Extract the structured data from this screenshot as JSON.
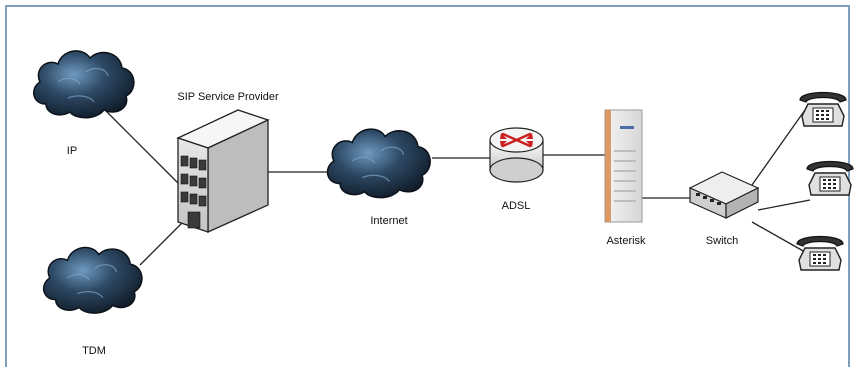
{
  "nodes": {
    "ip": {
      "label": "IP",
      "icon": "cloud-icon"
    },
    "tdm": {
      "label": "TDM",
      "icon": "cloud-icon"
    },
    "sip_provider": {
      "label": "SIP Service Provider",
      "icon": "building-icon"
    },
    "internet": {
      "label": "Internet",
      "icon": "cloud-icon"
    },
    "adsl": {
      "label": "ADSL",
      "icon": "router-icon"
    },
    "asterisk": {
      "label": "Asterisk",
      "icon": "pbx-server-icon"
    },
    "switch": {
      "label": "Switch",
      "icon": "network-switch-icon"
    },
    "phones": [
      {
        "icon": "telephone-icon"
      },
      {
        "icon": "telephone-icon"
      },
      {
        "icon": "telephone-icon"
      }
    ]
  },
  "colors": {
    "border": "#7f9fbf",
    "cloud_dark": "#1b2a3a",
    "cloud_light": "#5a88b0",
    "router_arrow": "#cc1f1f",
    "asterisk_accent": "#d98a4a"
  }
}
